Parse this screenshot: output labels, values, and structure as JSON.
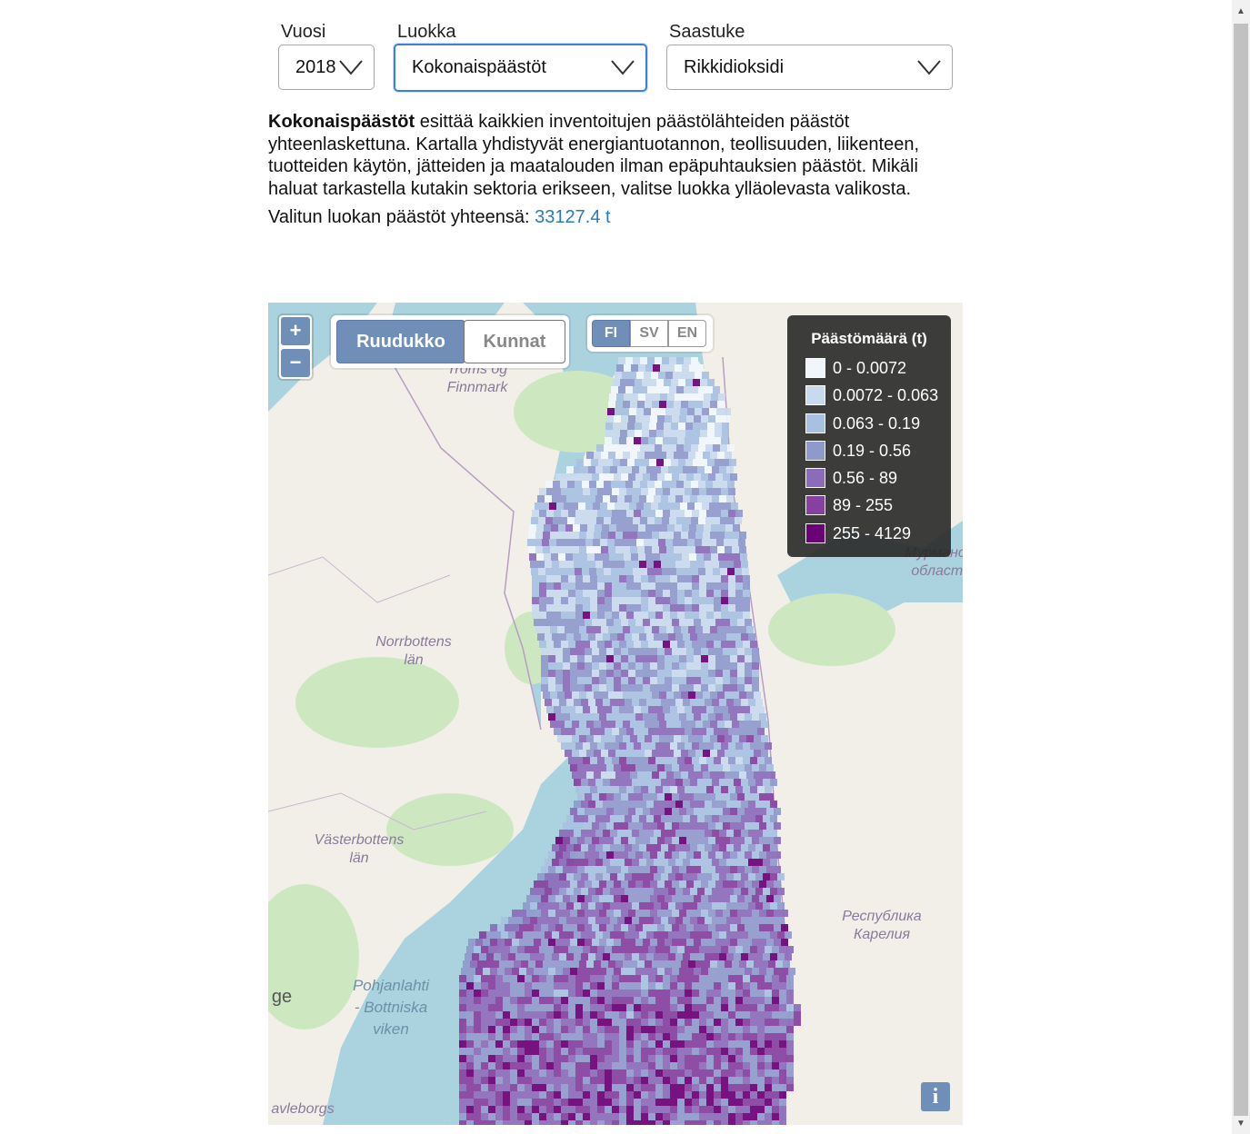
{
  "filters": {
    "year": {
      "label": "Vuosi",
      "value": "2018"
    },
    "category": {
      "label": "Luokka",
      "value": "Kokonaispäästöt"
    },
    "pollutant": {
      "label": "Saastuke",
      "value": "Rikkidioksidi"
    }
  },
  "description": {
    "bold": "Kokonaispäästöt",
    "text": " esittää kaikkien inventoitujen päästölähteiden päästöt yhteenlaskettuna. Kartalla yhdistyvät energiantuotannon, teollisuuden, liikenteen, tuotteiden käytön, jätteiden ja maatalouden ilman epäpuhtauksien päästöt. Mikäli haluat tarkastella kutakin sektoria erikseen, valitse luokka ylläolevasta valikosta."
  },
  "total": {
    "label": "Valitun luokan päästöt yhteensä: ",
    "value": "33127.4 t"
  },
  "map": {
    "zoom_in": "+",
    "zoom_out": "−",
    "view_toggle": {
      "active": "Ruudukko",
      "inactive": "Kunnat"
    },
    "languages": [
      "FI",
      "SV",
      "EN"
    ],
    "active_language": "FI",
    "info_button": "i",
    "places": {
      "troms": "Troms og Finnmark",
      "norrbotten": "Norrbottens län",
      "vasterbotten": "Västerbottens län",
      "murmansk": "Мурманская область",
      "karelia": "Республика Карелия",
      "bothnia": "Pohjanlahti - Bottniska viken",
      "ge": "ge",
      "gavleborg": "avleborgs"
    }
  },
  "legend": {
    "title": "Päästömäärä (t)",
    "classes": [
      {
        "label": "0 - 0.0072",
        "color": "#f1f6fb"
      },
      {
        "label": "0.0072 - 0.063",
        "color": "#c9d9ee"
      },
      {
        "label": "0.063 - 0.19",
        "color": "#a8c0e2"
      },
      {
        "label": "0.19 - 0.56",
        "color": "#8f99cc"
      },
      {
        "label": "0.56 - 89",
        "color": "#8c6bba"
      },
      {
        "label": "89 - 255",
        "color": "#86409f"
      },
      {
        "label": "255 - 4129",
        "color": "#6b0077"
      }
    ]
  }
}
